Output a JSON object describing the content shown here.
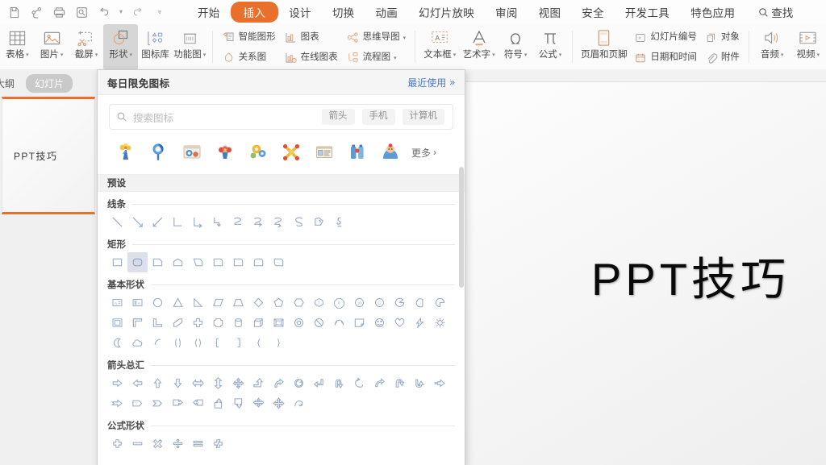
{
  "app": {
    "quick_access": [
      {
        "name": "save-icon",
        "label": "保存"
      },
      {
        "name": "share-icon",
        "label": "分享"
      },
      {
        "name": "print-icon",
        "label": "打印"
      },
      {
        "name": "print-preview-icon",
        "label": "打印预览"
      },
      {
        "name": "undo-icon",
        "label": "撤销"
      },
      {
        "name": "redo-icon",
        "label": "恢复"
      },
      {
        "name": "customize-qat-icon",
        "label": "自定义快速访问工具栏"
      }
    ]
  },
  "menubar": {
    "tabs": [
      {
        "label": "开始",
        "active": false
      },
      {
        "label": "插入",
        "active": true
      },
      {
        "label": "设计",
        "active": false
      },
      {
        "label": "切换",
        "active": false
      },
      {
        "label": "动画",
        "active": false
      },
      {
        "label": "幻灯片放映",
        "active": false
      },
      {
        "label": "审阅",
        "active": false
      },
      {
        "label": "视图",
        "active": false
      },
      {
        "label": "安全",
        "active": false
      },
      {
        "label": "开发工具",
        "active": false
      },
      {
        "label": "特色应用",
        "active": false
      }
    ],
    "find_label": "查找",
    "active_color": "#e8702a"
  },
  "ribbon": {
    "big_buttons": [
      {
        "label": "表格",
        "icon": "table-icon",
        "caret": true,
        "active": false
      },
      {
        "label": "图片",
        "icon": "picture-icon",
        "caret": true,
        "active": false
      },
      {
        "label": "截屏",
        "icon": "screenshot-icon",
        "caret": true,
        "active": false
      },
      {
        "label": "形状",
        "icon": "shapes-icon",
        "caret": true,
        "active": true
      },
      {
        "label": "图标库",
        "icon": "icon-library-icon",
        "caret": false,
        "active": false
      },
      {
        "label": "功能图",
        "icon": "function-chart-icon",
        "caret": true,
        "active": false
      }
    ],
    "small_buttons": [
      {
        "label": "智能图形",
        "icon": "smart-graphic-icon",
        "caret": false
      },
      {
        "label": "关系图",
        "icon": "relation-chart-icon",
        "caret": false
      },
      {
        "label": "图表",
        "icon": "chart-icon",
        "caret": false
      },
      {
        "label": "在线图表",
        "icon": "online-chart-icon",
        "caret": false
      },
      {
        "label": "思维导图",
        "icon": "mindmap-icon",
        "caret": true
      },
      {
        "label": "流程图",
        "icon": "flowchart-icon",
        "caret": true
      }
    ],
    "text_buttons": [
      {
        "label": "文本框",
        "icon": "textbox-icon",
        "caret": true
      },
      {
        "label": "艺术字",
        "icon": "wordart-icon",
        "caret": true
      },
      {
        "label": "符号",
        "icon": "symbol-icon",
        "caret": true
      },
      {
        "label": "公式",
        "icon": "formula-icon",
        "caret": true
      }
    ],
    "header_button": {
      "label": "页眉和页脚",
      "icon": "header-footer-icon"
    },
    "meta_buttons": [
      {
        "label": "幻灯片编号",
        "icon": "slide-number-icon"
      },
      {
        "label": "日期和时间",
        "icon": "date-time-icon"
      },
      {
        "label": "对象",
        "icon": "object-icon"
      },
      {
        "label": "附件",
        "icon": "attachment-icon"
      }
    ],
    "media_buttons": [
      {
        "label": "音频",
        "icon": "audio-icon",
        "caret": true
      },
      {
        "label": "视频",
        "icon": "video-icon",
        "caret": true
      }
    ]
  },
  "sidebar": {
    "tabs": [
      {
        "label": "大纲",
        "active": false
      },
      {
        "label": "幻灯片",
        "active": true
      }
    ],
    "slides": [
      {
        "number": 1,
        "text": "PPT技巧",
        "selected": true
      }
    ],
    "selection_color": "#e8702a"
  },
  "slide_area": {
    "title": "PPT技巧"
  },
  "shapes_panel": {
    "header": {
      "title": "每日限免图标",
      "recent_label": "最近使用",
      "recent_chevron": "»"
    },
    "search": {
      "placeholder": "搜索图标",
      "icon": "search-icon",
      "tags": [
        "箭头",
        "手机",
        "计算机"
      ]
    },
    "daily_icons": [
      {
        "name": "flower-bouquet-icon"
      },
      {
        "name": "magnifier-blue-icon"
      },
      {
        "name": "camera-window-icon"
      },
      {
        "name": "red-flower-icon"
      },
      {
        "name": "gear-flower-icon"
      },
      {
        "name": "network-node-icon"
      },
      {
        "name": "news-card-icon"
      },
      {
        "name": "bottles-icon"
      },
      {
        "name": "person-head-icon"
      }
    ],
    "more_label": "更多",
    "preset_label": "预设",
    "groups": [
      {
        "title": "线条",
        "shapes": [
          "line",
          "line-arrow",
          "line-double-arrow",
          "elbow-connector",
          "elbow-arrow-1",
          "elbow-arrow-2",
          "curve-connector",
          "curve-arrow-1",
          "curve-arrow-2",
          "curve-s",
          "freeform",
          "scribble"
        ]
      },
      {
        "title": "矩形",
        "shapes": [
          "rectangle",
          "rounded-rectangle",
          "snip-single-corner",
          "round-single-corner-top",
          "snip-diagonal-corner",
          "snip-round-single-corner",
          "round-single-corner",
          "round-same-side-corner",
          "round-diagonal-corner"
        ],
        "selected_index": 1
      },
      {
        "title": "基本形状",
        "shapes": [
          "text-box",
          "vertical-text-box",
          "oval",
          "triangle",
          "right-triangle",
          "parallelogram",
          "trapezoid",
          "diamond",
          "pentagon",
          "hexagon",
          "heptagon",
          "octagon",
          "decagon",
          "dodecagon",
          "pie",
          "chord",
          "teardrop",
          "frame",
          "corner",
          "l-shape",
          "diagonal-stripe",
          "cross",
          "regular-pentagon-block",
          "cylinder",
          "cube",
          "bevel",
          "donut",
          "no-symbol",
          "arc",
          "folded-corner",
          "smiley-face",
          "heart",
          "lightning-bolt",
          "sun",
          "moon",
          "cloud",
          "arc-open",
          "round-bracket",
          "round-brace",
          "square-bracket",
          "square-bracket-right",
          "curly-brace-left",
          "curly-brace-right"
        ]
      },
      {
        "title": "箭头总汇",
        "shapes": [
          "right-arrow",
          "left-arrow",
          "up-arrow",
          "down-arrow",
          "left-right-arrow",
          "up-down-arrow",
          "quad-arrow",
          "bent-up-arrow",
          "curved-right-arrow",
          "circular-arrow",
          "bent-arrow",
          "u-turn-arrow",
          "left-circular-arrow",
          "swoosh-arrow",
          "curved-up-arrow",
          "curved-down-arrow",
          "striped-right-arrow",
          "notched-right-arrow",
          "pentagon-arrow",
          "chevron-arrow",
          "right-arrow-callout",
          "left-arrow-callout",
          "up-arrow-callout",
          "down-arrow-callout",
          "quad-arrow-callout",
          "cross-arrow-callout",
          "curved-connector-arrow"
        ]
      },
      {
        "title": "公式形状",
        "shapes": [
          "plus-sign",
          "minus-sign",
          "multiply-sign",
          "division-sign",
          "equal-sign",
          "not-equal-sign"
        ]
      }
    ]
  }
}
